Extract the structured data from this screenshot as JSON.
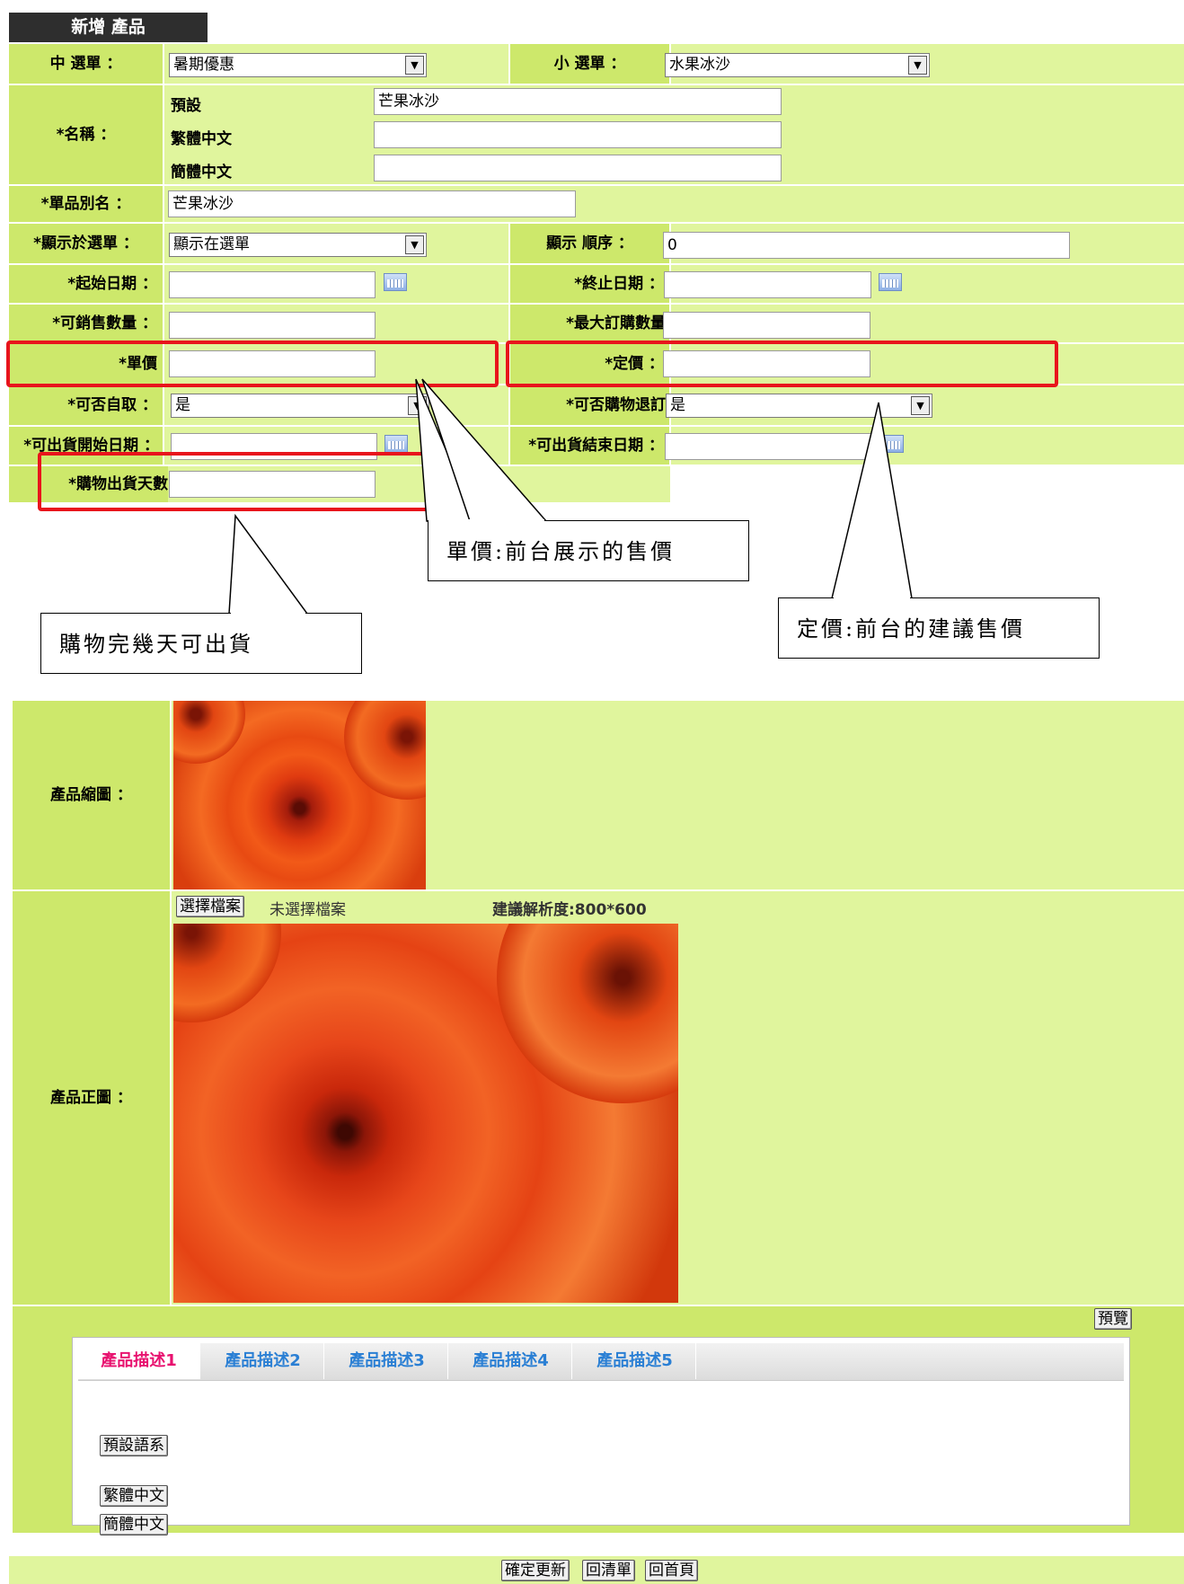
{
  "header": {
    "title": "新增 產品"
  },
  "form": {
    "mid_menu_label": "中 選單 ：",
    "mid_menu_value": "暑期優惠",
    "sub_menu_label": "小 選單 ：",
    "sub_menu_value": "水果冰沙",
    "name_label": "*名稱 ：",
    "name_default_label": "預設",
    "name_default_value": "芒果冰沙",
    "name_tc_label": "繁體中文",
    "name_tc_value": "",
    "name_sc_label": "簡體中文",
    "name_sc_value": "",
    "alias_label": "*單品別名 ：",
    "alias_value": "芒果冰沙",
    "show_label": "*顯示於選單 ：",
    "show_value": "顯示在選單",
    "order_label": "顯示 順序 ：",
    "order_value": "0",
    "start_date_label": "*起始日期 ：",
    "start_date_value": "",
    "end_date_label": "*終止日期 ：",
    "end_date_value": "",
    "sellable_qty_label": "*可銷售數量 ：",
    "sellable_qty_value": "",
    "max_order_label": "*最大訂購數量",
    "max_order_value": "",
    "unit_price_label": "*單價",
    "unit_price_value": "",
    "list_price_label": "*定價 ：",
    "list_price_value": "",
    "pickup_label": "*可否自取 ：",
    "pickup_value": "是",
    "refund_label": "*可否購物退訂",
    "refund_value": "是",
    "ship_start_label": "*可出貨開始日期 ：",
    "ship_start_value": "",
    "ship_end_label": "*可出貨結束日期 ：",
    "ship_end_value": "",
    "ship_days_label": "*購物出貨天數",
    "ship_days_value": ""
  },
  "callouts": {
    "unit_price": "單價:前台展示的售價",
    "list_price": "定價:前台的建議售價",
    "ship_days": "購物完幾天可出貨"
  },
  "images": {
    "thumb_label": "產品縮圖 ：",
    "main_label": "產品正圖 ：",
    "choose_file_button": "選擇檔案",
    "no_file_text": "未選擇檔案",
    "resolution_hint": "建議解析度:800*600"
  },
  "description": {
    "preview_button": "預覽",
    "tabs": [
      "產品描述1",
      "產品描述2",
      "產品描述3",
      "產品描述4",
      "產品描述5"
    ],
    "lang_default_button": "預設語系",
    "lang_tc_button": "繁體中文",
    "lang_sc_button": "簡體中文"
  },
  "footer": {
    "confirm_button": "確定更新",
    "back_list_button": "回清單",
    "home_button": "回首頁"
  },
  "colors": {
    "label_bg": "#cde86b",
    "value_bg": "#e0f59d",
    "highlight": "#e8141c",
    "tab_active": "#e8116f",
    "tab_inactive": "#2a7fd4"
  }
}
